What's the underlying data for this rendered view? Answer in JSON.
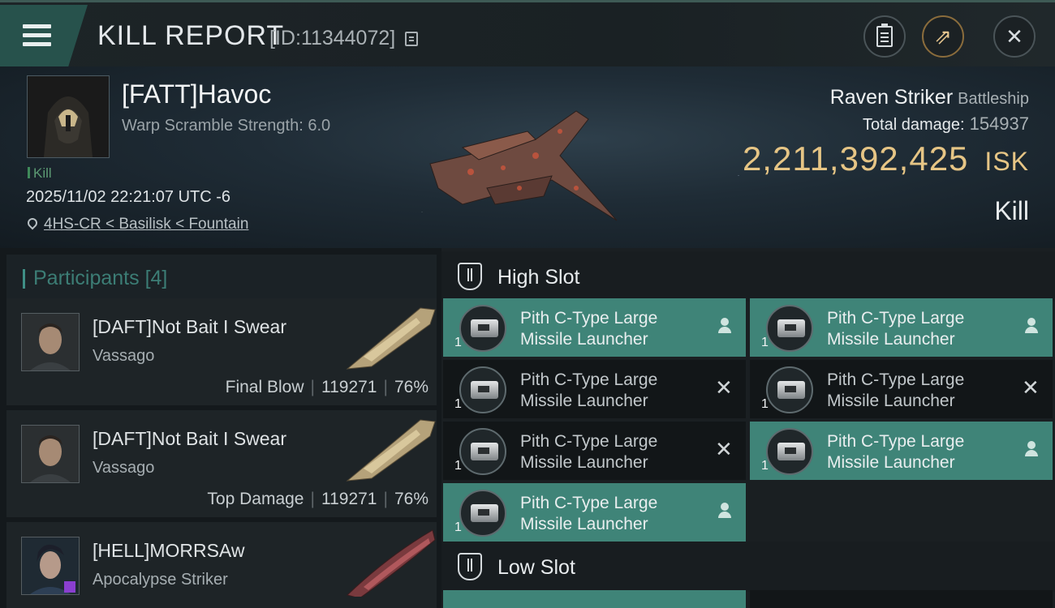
{
  "header": {
    "title": "KILL REPORT",
    "report_id": "[ID:11344072]"
  },
  "victim": {
    "name": "[FATT]Havoc",
    "warp_scramble": "Warp Scramble Strength: 6.0",
    "kill_tag": "Kill",
    "timestamp": "2025/11/02 22:21:07 UTC -6",
    "location": "4HS-CR < Basilisk < Fountain",
    "ship_name": "Raven Striker",
    "ship_class": "Battleship",
    "total_damage_label": "Total damage:",
    "total_damage": "154937",
    "isk_value": "2,211,392,425",
    "isk_unit": "ISK",
    "result": "Kill"
  },
  "participants": {
    "label": "Participants",
    "count": "[4]",
    "items": [
      {
        "name": "[DAFT]Not Bait I Swear",
        "ship": "Vassago",
        "role": "Final Blow",
        "damage": "119271",
        "percent": "76%"
      },
      {
        "name": "[DAFT]Not Bait I Swear",
        "ship": "Vassago",
        "role": "Top Damage",
        "damage": "119271",
        "percent": "76%"
      },
      {
        "name": "[HELL]MORRSAw",
        "ship": "Apocalypse Striker"
      }
    ]
  },
  "high_slot": {
    "label": "High Slot",
    "modules": [
      {
        "line1": "Pith C-Type Large",
        "line2": "Missile Launcher",
        "qty": "1",
        "status": "dropped"
      },
      {
        "line1": "Pith C-Type Large",
        "line2": "Missile Launcher",
        "qty": "1",
        "status": "dropped"
      },
      {
        "line1": "Pith C-Type Large",
        "line2": "Missile Launcher",
        "qty": "1",
        "status": "destroyed"
      },
      {
        "line1": "Pith C-Type Large",
        "line2": "Missile Launcher",
        "qty": "1",
        "status": "destroyed"
      },
      {
        "line1": "Pith C-Type Large",
        "line2": "Missile Launcher",
        "qty": "1",
        "status": "destroyed"
      },
      {
        "line1": "Pith C-Type Large",
        "line2": "Missile Launcher",
        "qty": "1",
        "status": "dropped"
      },
      {
        "line1": "Pith C-Type Large",
        "line2": "Missile Launcher",
        "qty": "1",
        "status": "dropped"
      }
    ]
  },
  "low_slot": {
    "label": "Low Slot"
  },
  "colors": {
    "accent": "#3f8478",
    "isk": "#e6c585",
    "kill_green": "#5c9a73"
  }
}
